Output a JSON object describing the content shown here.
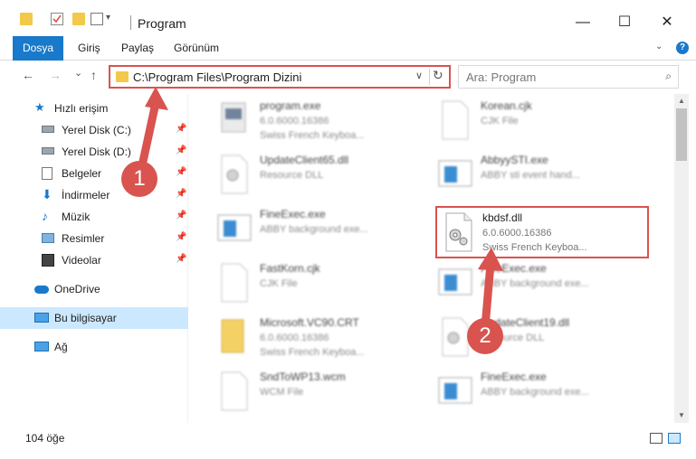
{
  "window": {
    "title": "Program",
    "minimize": "—",
    "maximize": "☐",
    "close": "✕"
  },
  "ribbon": {
    "tabs": [
      "Dosya",
      "Giriş",
      "Paylaş",
      "Görünüm"
    ],
    "help": "?"
  },
  "nav": {
    "back": "←",
    "forward": "→",
    "recent": "⌄",
    "up": "↑",
    "address": "C:\\Program Files\\Program Dizini",
    "dropdown": "∨",
    "refresh": "↻"
  },
  "search": {
    "placeholder": "Ara: Program",
    "icon": "⌕"
  },
  "sidebar": {
    "items": [
      {
        "label": "Hızlı erişim",
        "icon": "star-icon",
        "pinned": false
      },
      {
        "label": "Yerel Disk (C:)",
        "icon": "drive-icon",
        "pinned": true
      },
      {
        "label": "Yerel Disk (D:)",
        "icon": "drive-icon",
        "pinned": true
      },
      {
        "label": "Belgeler",
        "icon": "documents-icon",
        "pinned": true
      },
      {
        "label": "İndirmeler",
        "icon": "download-icon",
        "pinned": true
      },
      {
        "label": "Müzik",
        "icon": "music-icon",
        "pinned": true
      },
      {
        "label": "Resimler",
        "icon": "pictures-icon",
        "pinned": true
      },
      {
        "label": "Videolar",
        "icon": "videos-icon",
        "pinned": true
      },
      {
        "label": "OneDrive",
        "icon": "cloud-icon",
        "pinned": false
      },
      {
        "label": "Bu bilgisayar",
        "icon": "computer-icon",
        "pinned": false
      },
      {
        "label": "Ağ",
        "icon": "network-icon",
        "pinned": false
      }
    ],
    "pin_glyph": "📌"
  },
  "files": [
    {
      "name": "program.exe",
      "l2": "6.0.6000.16386",
      "l3": "Swiss French Keyboa...",
      "icon": "exe-icon"
    },
    {
      "name": "Korean.cjk",
      "l2": "CJK File",
      "l3": "",
      "icon": "blank-file-icon"
    },
    {
      "name": "UpdateClient65.dll",
      "l2": "Resource DLL",
      "l3": "",
      "icon": "dll-icon"
    },
    {
      "name": "AbbyySTI.exe",
      "l2": "ABBY sti event hand...",
      "l3": "",
      "icon": "app-window-icon"
    },
    {
      "name": "FineExec.exe",
      "l2": "ABBY background exe...",
      "l3": "",
      "icon": "app-window-icon"
    },
    {
      "name": "kbdsf.dll",
      "l2": "6.0.6000.16386",
      "l3": "Swiss French Keyboa...",
      "icon": "dll-icon"
    },
    {
      "name": "FastKorn.cjk",
      "l2": "CJK File",
      "l3": "",
      "icon": "blank-file-icon"
    },
    {
      "name": "FineExec.exe",
      "l2": "ABBY background exe...",
      "l3": "",
      "icon": "app-window-icon"
    },
    {
      "name": "Microsoft.VC90.CRT",
      "l2": "6.0.6000.16386",
      "l3": "Swiss French Keyboa...",
      "icon": "folder-file-icon"
    },
    {
      "name": "UpdateClient19.dll",
      "l2": "Resource DLL",
      "l3": "",
      "icon": "dll-icon"
    },
    {
      "name": "SndToWP13.wcm",
      "l2": "WCM File",
      "l3": "",
      "icon": "blank-file-icon"
    },
    {
      "name": "FineExec.exe",
      "l2": "ABBY background exe...",
      "l3": "",
      "icon": "app-window-icon"
    }
  ],
  "status": {
    "count": "104 öğe"
  },
  "annotations": {
    "step1": "1",
    "step2": "2",
    "accent": "#d9534f"
  },
  "colors": {
    "ribbon_active": "#1979ca",
    "selected_nav": "#cce8ff",
    "highlight_border": "#d9534f",
    "folder": "#f3c94a"
  }
}
